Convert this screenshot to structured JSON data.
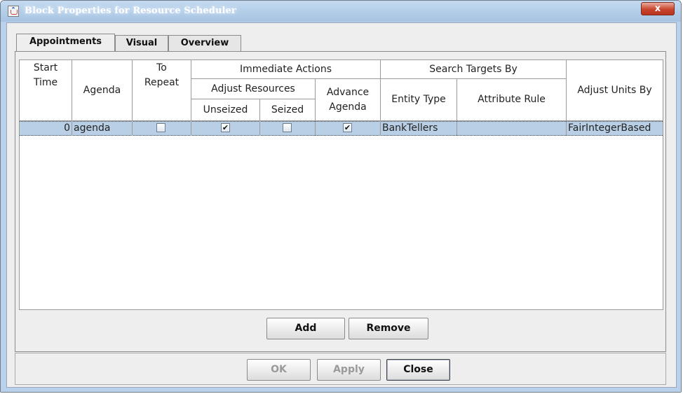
{
  "window": {
    "title": "Block Properties for Resource Scheduler",
    "close_glyph": "x"
  },
  "tabs": [
    {
      "label": "Appointments",
      "selected": true
    },
    {
      "label": "Visual",
      "selected": false
    },
    {
      "label": "Overview",
      "selected": false
    }
  ],
  "table": {
    "headers": {
      "start_time_1": "Start",
      "start_time_2": "Time",
      "agenda": "Agenda",
      "to_repeat_1": "To",
      "to_repeat_2": "Repeat",
      "immediate_actions": "Immediate Actions",
      "adjust_resources": "Adjust Resources",
      "unseized": "Unseized",
      "seized": "Seized",
      "advance_agenda_1": "Advance",
      "advance_agenda_2": "Agenda",
      "search_targets_by": "Search Targets By",
      "entity_type": "Entity Type",
      "attribute_rule": "Attribute Rule",
      "adjust_units_by": "Adjust Units By"
    },
    "rows": [
      {
        "start_time": "0",
        "agenda": "agenda",
        "to_repeat": false,
        "unseized": true,
        "seized": false,
        "advance_agenda": true,
        "entity_type": "BankTellers",
        "attribute_rule": "",
        "adjust_units_by": "FairIntegerBased",
        "check_glyph": "✔"
      }
    ]
  },
  "buttons": {
    "add": "Add",
    "remove": "Remove",
    "ok": "OK",
    "apply": "Apply",
    "close": "Close"
  },
  "states": {
    "ok_enabled": false,
    "apply_enabled": false
  }
}
